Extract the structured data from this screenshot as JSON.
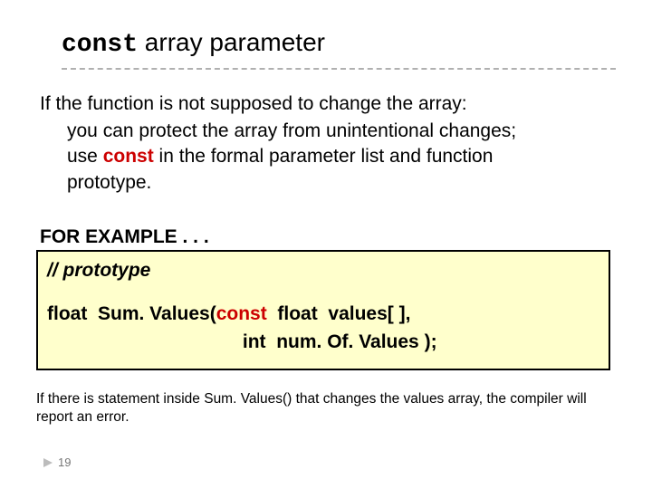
{
  "title": {
    "mono": "const",
    "rest": " array parameter"
  },
  "body": {
    "line1": "If the function is not supposed to change the array:",
    "line2": "you can protect the array from unintentional changes;",
    "line3a": "use ",
    "line3_kw": "const",
    "line3b": " in the formal parameter list and function",
    "line4": "prototype."
  },
  "example_label": "FOR EXAMPLE . . .",
  "code": {
    "comment": "// prototype",
    "l1a": "float  Sum. Values(",
    "l1_kw": "const",
    "l1b": "  float  values[ ],",
    "l2": "                                     int  num. Of. Values );"
  },
  "footer": {
    "text": "If there is statement inside Sum. Values() that changes the values array, the compiler will report an error."
  },
  "page_number": "19"
}
